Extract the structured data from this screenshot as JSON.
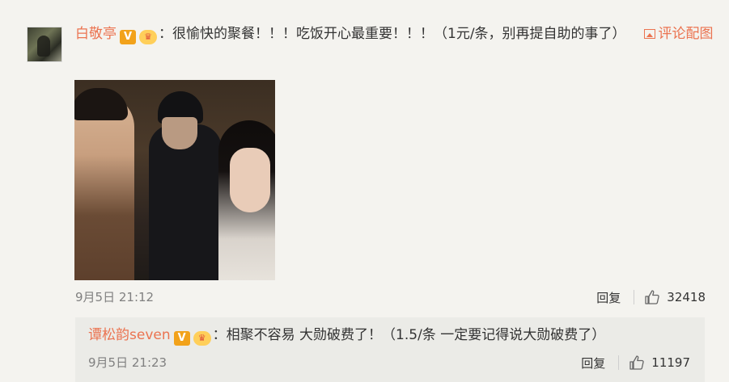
{
  "post": {
    "author": "白敬亭",
    "verified_badge": "V",
    "member_badge": "vip-crown-icon",
    "separator": "：",
    "text": "很愉快的聚餐！！！吃饭开心最重要！！！（1元/条，别再提自助的事了）",
    "pic_link": "评论配图",
    "time": "9月5日 21:12",
    "reply_label": "回复",
    "like_count": "32418"
  },
  "reply": {
    "author": "谭松韵seven",
    "verified_badge": "V",
    "member_badge": "vip-crown-icon",
    "separator": "：",
    "text": "相聚不容易 大勋破费了！（1.5/条 一定要记得说大勋破费了）",
    "time": "9月5日 21:23",
    "reply_label": "回复",
    "like_count": "11197"
  },
  "colors": {
    "link": "#eb7350",
    "background": "#f4f3ef",
    "reply_background": "#ebebe7",
    "meta": "#808080"
  }
}
